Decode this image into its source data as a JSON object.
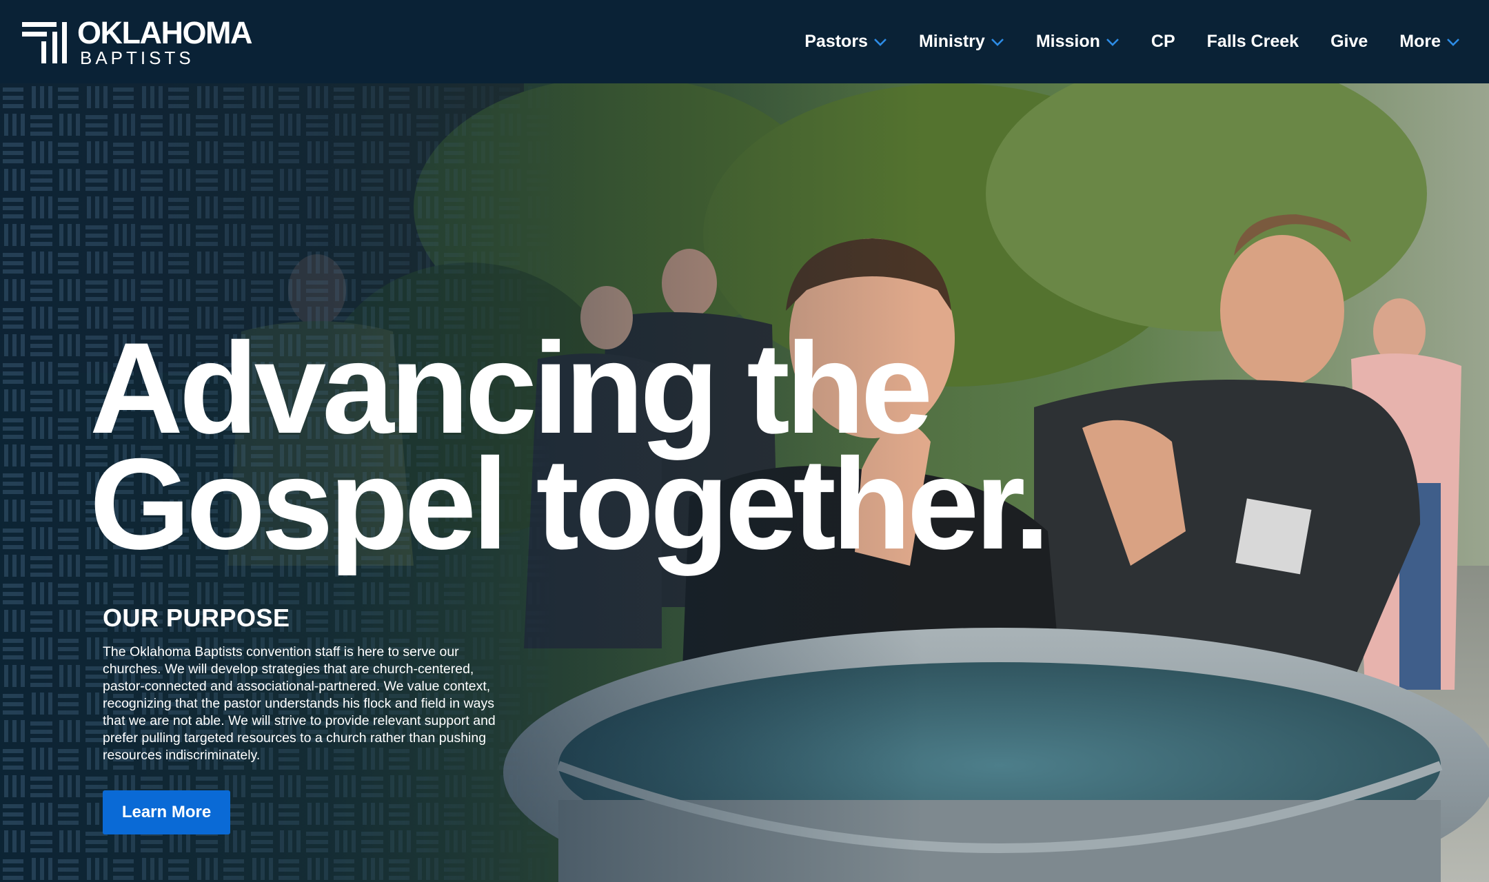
{
  "brand": {
    "name_line1": "OKLAHOMA",
    "name_line2": "BAPTISTS",
    "colors": {
      "header_bg": "#0a2236",
      "button_bg": "#0a6ad6",
      "text": "#ffffff"
    }
  },
  "nav": {
    "items": [
      {
        "label": "Pastors",
        "dropdown": true
      },
      {
        "label": "Ministry",
        "dropdown": true
      },
      {
        "label": "Mission",
        "dropdown": true
      },
      {
        "label": "CP",
        "dropdown": false
      },
      {
        "label": "Falls Creek",
        "dropdown": false
      },
      {
        "label": "Give",
        "dropdown": false
      },
      {
        "label": "More",
        "dropdown": true
      }
    ],
    "icon": "chevron-down-icon"
  },
  "hero": {
    "title_line1": "Advancing the",
    "title_line2": "Gospel together.",
    "purpose_heading": "OUR PURPOSE",
    "purpose_body": "The Oklahoma Baptists convention staff is here to serve our churches. We will develop strategies that are church-centered, pastor-connected and associational-partnered. We value context, recognizing that the pastor understands his flock and field in ways that we are not able. We will strive to provide relevant support and prefer pulling targeted resources to a church rather than pushing resources indiscriminately.",
    "cta_label": "Learn More"
  }
}
